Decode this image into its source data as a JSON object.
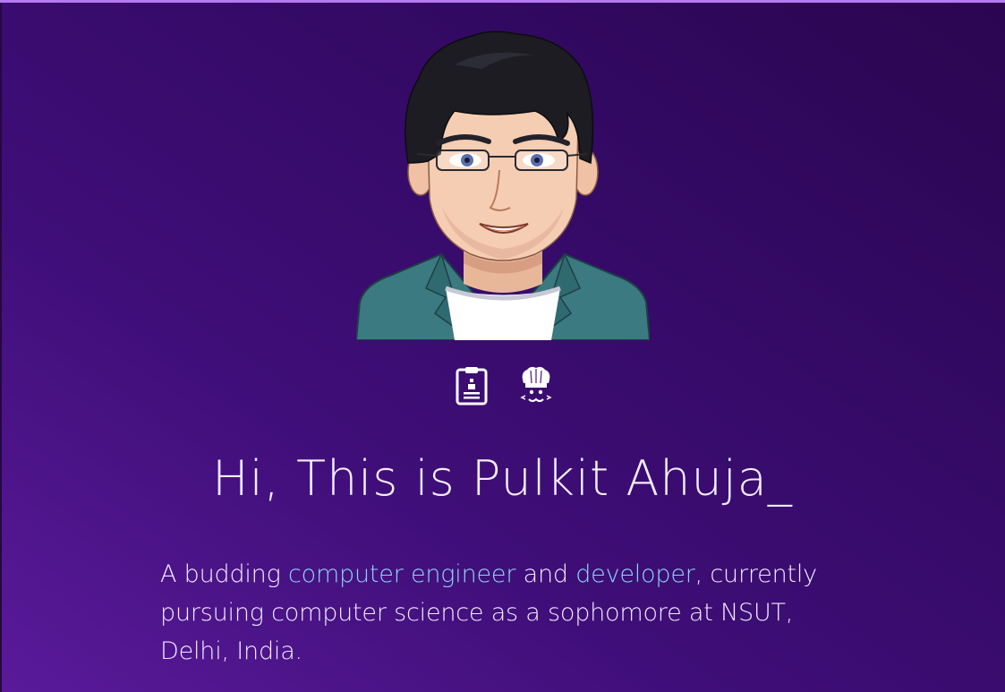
{
  "hero": {
    "greeting": "Hi, This is Pulkit Ahuja",
    "cursor": "_"
  },
  "icons": [
    {
      "name": "resume-icon"
    },
    {
      "name": "codechef-icon"
    }
  ],
  "bio": {
    "part1": "A budding ",
    "link1": "computer engineer",
    "part2": " and ",
    "link2": "developer",
    "part3": ", currently pursuing computer science as a sophomore at NSUT, Delhi, India."
  },
  "colors": {
    "accent_link": "#8fd3f4",
    "top_bar": "#b57bf0",
    "background_dark": "#2b0550",
    "background_light": "#5a1a9a"
  }
}
